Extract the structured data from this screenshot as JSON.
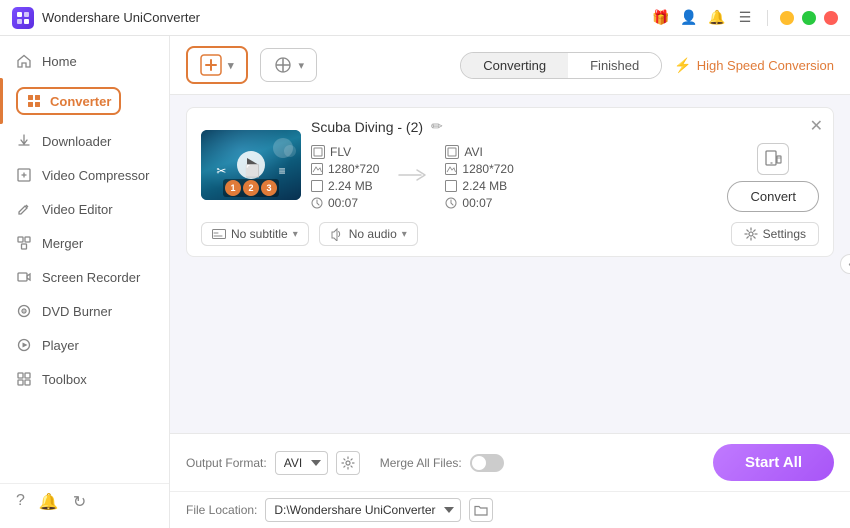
{
  "app": {
    "title": "Wondershare UniConverter",
    "logo": "W"
  },
  "titlebar": {
    "controls": [
      "minimize",
      "maximize",
      "close"
    ]
  },
  "sidebar": {
    "items": [
      {
        "id": "home",
        "label": "Home",
        "icon": "🏠"
      },
      {
        "id": "converter",
        "label": "Converter",
        "icon": "⬛",
        "active": true
      },
      {
        "id": "downloader",
        "label": "Downloader",
        "icon": "⬇"
      },
      {
        "id": "video-compressor",
        "label": "Video Compressor",
        "icon": "🗜"
      },
      {
        "id": "video-editor",
        "label": "Video Editor",
        "icon": "✂"
      },
      {
        "id": "merger",
        "label": "Merger",
        "icon": "⊞"
      },
      {
        "id": "screen-recorder",
        "label": "Screen Recorder",
        "icon": "⬜"
      },
      {
        "id": "dvd-burner",
        "label": "DVD Burner",
        "icon": "💿"
      },
      {
        "id": "player",
        "label": "Player",
        "icon": "▶"
      },
      {
        "id": "toolbox",
        "label": "Toolbox",
        "icon": "⊞"
      }
    ],
    "collapse_label": "‹"
  },
  "toolbar": {
    "add_button_label": "+",
    "add_button2_label": "+",
    "tabs": [
      {
        "id": "converting",
        "label": "Converting",
        "active": true
      },
      {
        "id": "finished",
        "label": "Finished",
        "active": false
      }
    ],
    "high_speed_label": "High Speed Conversion"
  },
  "file_card": {
    "title": "Scuba Diving - (2)",
    "source_format": "FLV",
    "source_resolution": "1280*720",
    "source_size": "2.24 MB",
    "source_duration": "00:07",
    "target_format": "AVI",
    "target_resolution": "1280*720",
    "target_size": "2.24 MB",
    "target_duration": "00:07",
    "subtitle_label": "No subtitle",
    "audio_label": "No audio",
    "settings_label": "Settings",
    "convert_label": "Convert",
    "badges": [
      "1",
      "2",
      "3"
    ]
  },
  "bottom": {
    "output_format_label": "Output Format:",
    "output_format_value": "AVI",
    "file_location_label": "File Location:",
    "file_location_value": "D:\\Wondershare UniConverter",
    "merge_files_label": "Merge All Files:",
    "start_all_label": "Start All"
  }
}
